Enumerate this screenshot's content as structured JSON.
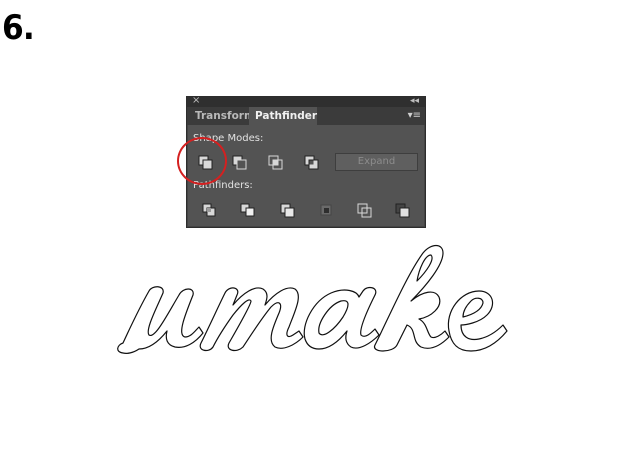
{
  "step": {
    "number": "6."
  },
  "panel": {
    "tabs": [
      {
        "label": "Transform",
        "active": false
      },
      {
        "label": "Pathfinder",
        "active": true
      }
    ],
    "shape_modes_label": "Shape Modes:",
    "pathfinders_label": "Pathfinders:",
    "shape_mode_buttons": [
      "unite-icon",
      "minus-front-icon",
      "intersect-icon",
      "exclude-icon"
    ],
    "pathfinder_buttons": [
      "divide-icon",
      "trim-icon",
      "merge-icon",
      "crop-icon",
      "outline-icon",
      "minus-back-icon"
    ],
    "expand_label": "Expand",
    "expand_enabled": false
  },
  "highlight": {
    "target": "unite-icon",
    "color": "#d42020"
  },
  "artwork": {
    "text": "umake"
  },
  "colors": {
    "panel_bg": "#535353",
    "tab_bar_bg": "#3b3b3b",
    "title_bar_bg": "#2f2f2f",
    "highlight_red": "#d42020"
  }
}
